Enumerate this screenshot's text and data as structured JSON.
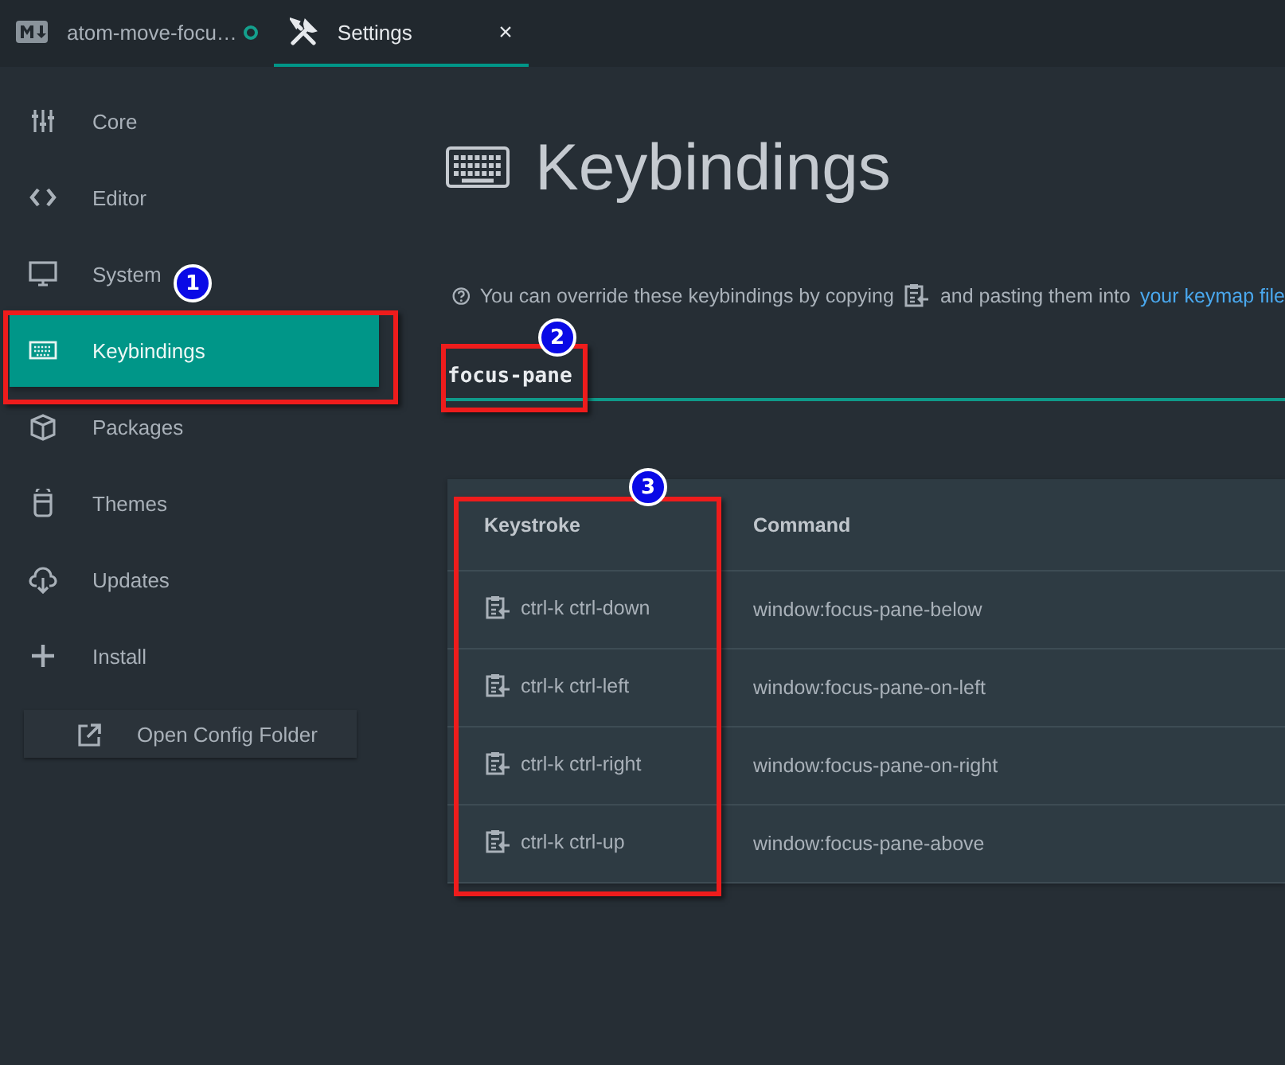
{
  "tabs": [
    {
      "title": "atom-move-focu…",
      "selected": false,
      "modified": true
    },
    {
      "title": "Settings",
      "selected": true,
      "modified": false,
      "close": "×"
    }
  ],
  "sidebar": {
    "items": [
      {
        "label": "Core",
        "selected": false
      },
      {
        "label": "Editor",
        "selected": false
      },
      {
        "label": "System",
        "selected": false
      },
      {
        "label": "Keybindings",
        "selected": true
      },
      {
        "label": "Packages",
        "selected": false
      },
      {
        "label": "Themes",
        "selected": false
      },
      {
        "label": "Updates",
        "selected": false
      },
      {
        "label": "Install",
        "selected": false
      }
    ],
    "button": "Open Config Folder"
  },
  "panel": {
    "title": "Keybindings",
    "info": {
      "before": "You can override these keybindings by copying",
      "after": "and pasting them into",
      "link": "your keymap file"
    },
    "search": {
      "value": "focus-pane"
    },
    "table": {
      "columns": [
        "Keystroke",
        "Command"
      ],
      "rows": [
        {
          "keystroke": "ctrl-k ctrl-down",
          "command": "window:focus-pane-below"
        },
        {
          "keystroke": "ctrl-k ctrl-left",
          "command": "window:focus-pane-on-left"
        },
        {
          "keystroke": "ctrl-k ctrl-right",
          "command": "window:focus-pane-on-right"
        },
        {
          "keystroke": "ctrl-k ctrl-up",
          "command": "window:focus-pane-above"
        }
      ]
    }
  },
  "annotations": [
    {
      "label": "1"
    },
    {
      "label": "2"
    },
    {
      "label": "3"
    }
  ]
}
